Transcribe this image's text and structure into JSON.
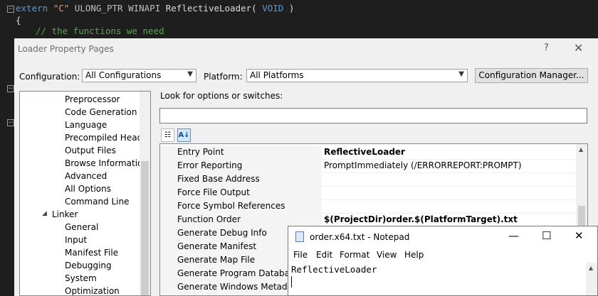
{
  "editor": {
    "line1": {
      "kw1": "extern",
      "str": "\"C\"",
      "t1": "ULONG_PTR",
      "t2": "WINAPI",
      "fn": "ReflectiveLoader(",
      "t3": "VOID",
      "close": ")"
    },
    "line2": "{",
    "line3": "// the functions we need"
  },
  "dialog": {
    "title": "Loader Property Pages",
    "help": "?",
    "close": "✕",
    "configuration_label": "Configuration:",
    "configuration_value": "All Configurations",
    "platform_label": "Platform:",
    "platform_value": "All Platforms",
    "config_manager": "Configuration Manager...",
    "search_label": "Look for options or switches:",
    "search_value": "",
    "tree": [
      "Preprocessor",
      "Code Generation",
      "Language",
      "Precompiled Heade",
      "Output Files",
      "Browse Information",
      "Advanced",
      "All Options",
      "Command Line",
      "Linker",
      "General",
      "Input",
      "Manifest File",
      "Debugging",
      "System",
      "Optimization"
    ],
    "tree_expander": "◢",
    "properties": [
      {
        "name": "Entry Point",
        "value": "ReflectiveLoader"
      },
      {
        "name": "Error Reporting",
        "value": "PromptImmediately (/ERRORREPORT:PROMPT)"
      },
      {
        "name": "Fixed Base Address",
        "value": ""
      },
      {
        "name": "Force File Output",
        "value": ""
      },
      {
        "name": "Force Symbol References",
        "value": ""
      },
      {
        "name": "Function Order",
        "value": "$(ProjectDir)order.$(PlatformTarget).txt"
      },
      {
        "name": "Generate Debug Info",
        "value": ""
      },
      {
        "name": "Generate Manifest",
        "value": ""
      },
      {
        "name": "Generate Map File",
        "value": ""
      },
      {
        "name": "Generate Program Database F",
        "value": ""
      },
      {
        "name": "Generate Windows Metadata",
        "value": ""
      }
    ]
  },
  "notepad": {
    "title": "order.x64.txt - Notepad",
    "menu": [
      "File",
      "Edit",
      "Format",
      "View",
      "Help"
    ],
    "content": "ReflectiveLoader",
    "min": "—",
    "max": "☐",
    "close": "✕"
  },
  "colors": {
    "keyword": "#569cd6",
    "comment": "#57a64a",
    "string": "#d69d85"
  }
}
